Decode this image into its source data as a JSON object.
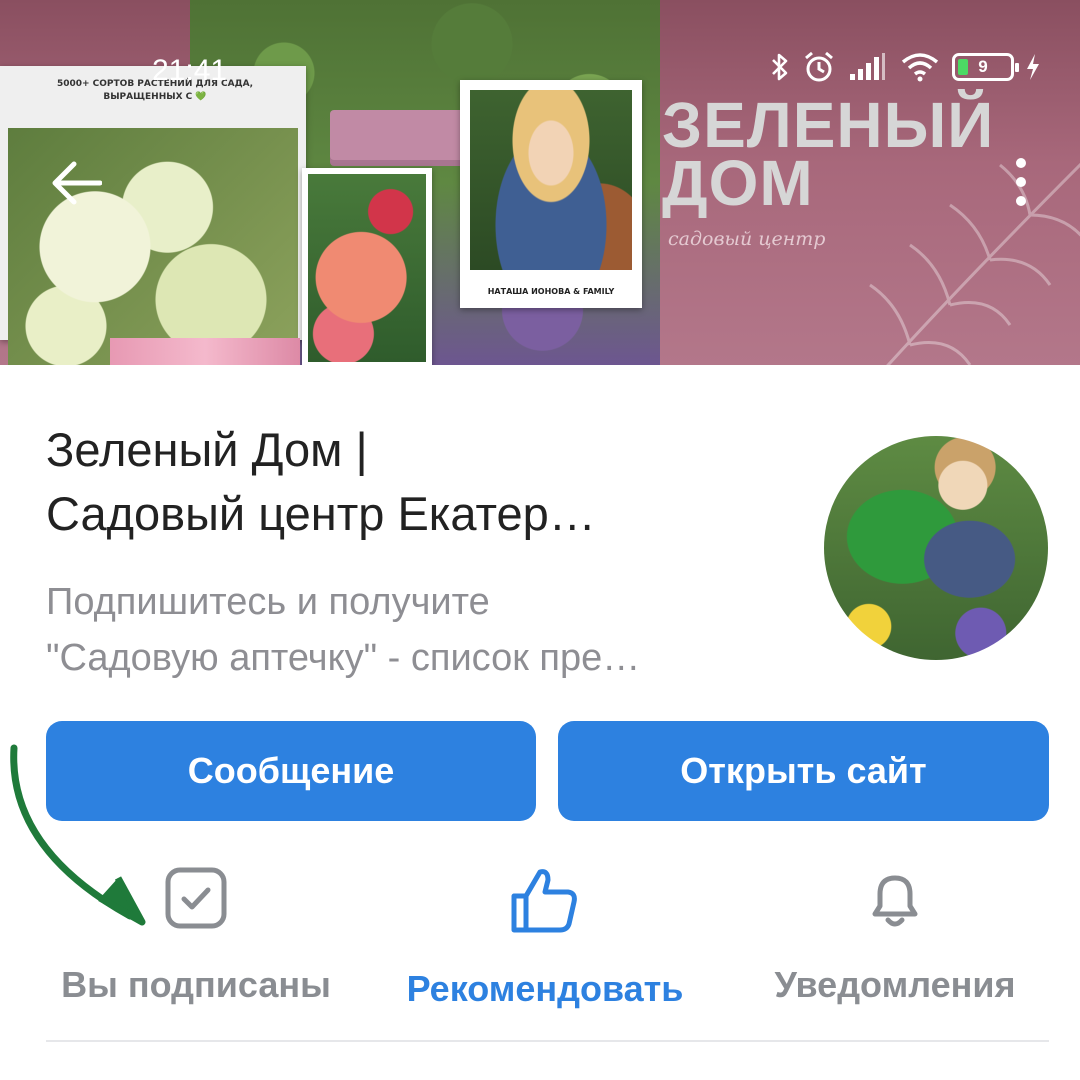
{
  "status_bar": {
    "time": "21:41",
    "battery_level": "9",
    "icons": [
      "bluetooth-icon",
      "alarm-icon",
      "signal-icon",
      "wifi-icon",
      "battery-icon",
      "charging-icon"
    ]
  },
  "cover": {
    "card1_caption": "5000+ СОРТОВ РАСТЕНИЙ ДЛЯ САДА, ВЫРАЩЕННЫХ С",
    "card1_heart": "💚",
    "card3_caption": "НАТАША ИОНОВА & FAMILY",
    "brand_title": "ЗЕЛЕНЫЙ\nДОМ",
    "brand_subtitle": "садовый центр"
  },
  "profile": {
    "title_line1": "Зеленый Дом |",
    "title_line2": "Садовый центр Екатер…",
    "description_line1": "Подпишитесь и получите",
    "description_line2": "\"Садовую аптечку\" - список пре…"
  },
  "buttons": {
    "message": "Сообщение",
    "open_site": "Открыть сайт"
  },
  "actions": {
    "subscribed": "Вы подписаны",
    "recommend": "Рекомендовать",
    "notifications": "Уведомления"
  },
  "colors": {
    "accent": "#2d81e0",
    "cover_bg": "#a8687b",
    "annotation_arrow": "#1f7a3a",
    "muted_text": "#8e8e93"
  }
}
